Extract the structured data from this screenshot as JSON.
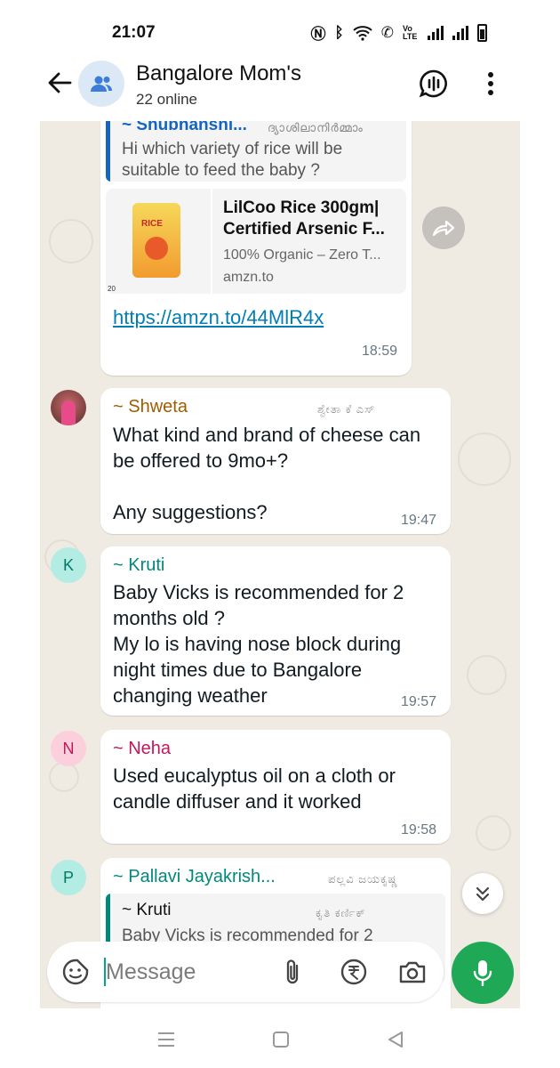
{
  "status_bar": {
    "time": "21:07",
    "network_label": "Vo LTE"
  },
  "header": {
    "title": "Bangalore Mom's",
    "subtitle": "22 online"
  },
  "messages": [
    {
      "quote": {
        "sender": "~ Shubhanshi...",
        "push_name": "ദ്യാശിലാനിർമ്മാം",
        "text": "Hi which variety of rice will be suitable to feed the baby ?"
      },
      "link_preview": {
        "title": "LilCoo Rice 300gm| Certified Arsenic F...",
        "description": "100% Organic – Zero T...",
        "domain": "amzn.to",
        "image_text": "RICE",
        "image_badge": "20"
      },
      "link": "https://amzn.to/44MlR4x",
      "time": "18:59"
    },
    {
      "sender": "~ Shweta",
      "push_name": "ಶ್ವೇತಾ ಕೆ ಎಸ್",
      "text": "What kind and brand of cheese can be offered to  9mo+?\n\nAny suggestions?",
      "time": "19:47"
    },
    {
      "sender": "~ Kruti",
      "avatar_letter": "K",
      "text": "Baby Vicks is recommended for 2 months old ?\nMy lo is having nose block during night times due to Bangalore changing weather",
      "time": "19:57"
    },
    {
      "sender": "~ Neha",
      "avatar_letter": "N",
      "text": "Used eucalyptus oil on a cloth or candle diffuser and it worked",
      "time": "19:58"
    },
    {
      "sender": "~ Pallavi Jayakrish...",
      "avatar_letter": "P",
      "push_name": "ಪಲ್ಲವಿ ಜಯಕೃಷ್ಣ",
      "quote": {
        "sender": "~ Kruti",
        "push_name": "ಕೃತಿ ಕರ್ಣಿಕ್",
        "text": "Baby Vicks is recommended for 2"
      }
    }
  ],
  "composer": {
    "placeholder": "Message"
  },
  "colors": {
    "shubhanshi": "#1565c0",
    "shweta": "#a05c00",
    "kruti": "#00897b",
    "neha": "#c2185b",
    "pallavi": "#00897b",
    "mic": "#1fa855",
    "link": "#027eb5"
  },
  "icons": [
    "back-arrow-icon",
    "group-icon",
    "voice-chat-icon",
    "more-options-icon",
    "forward-icon",
    "sticker-icon",
    "attach-icon",
    "rupee-icon",
    "camera-icon",
    "mic-icon",
    "scroll-down-icon",
    "nav-recents-icon",
    "nav-home-icon",
    "nav-back-icon"
  ]
}
